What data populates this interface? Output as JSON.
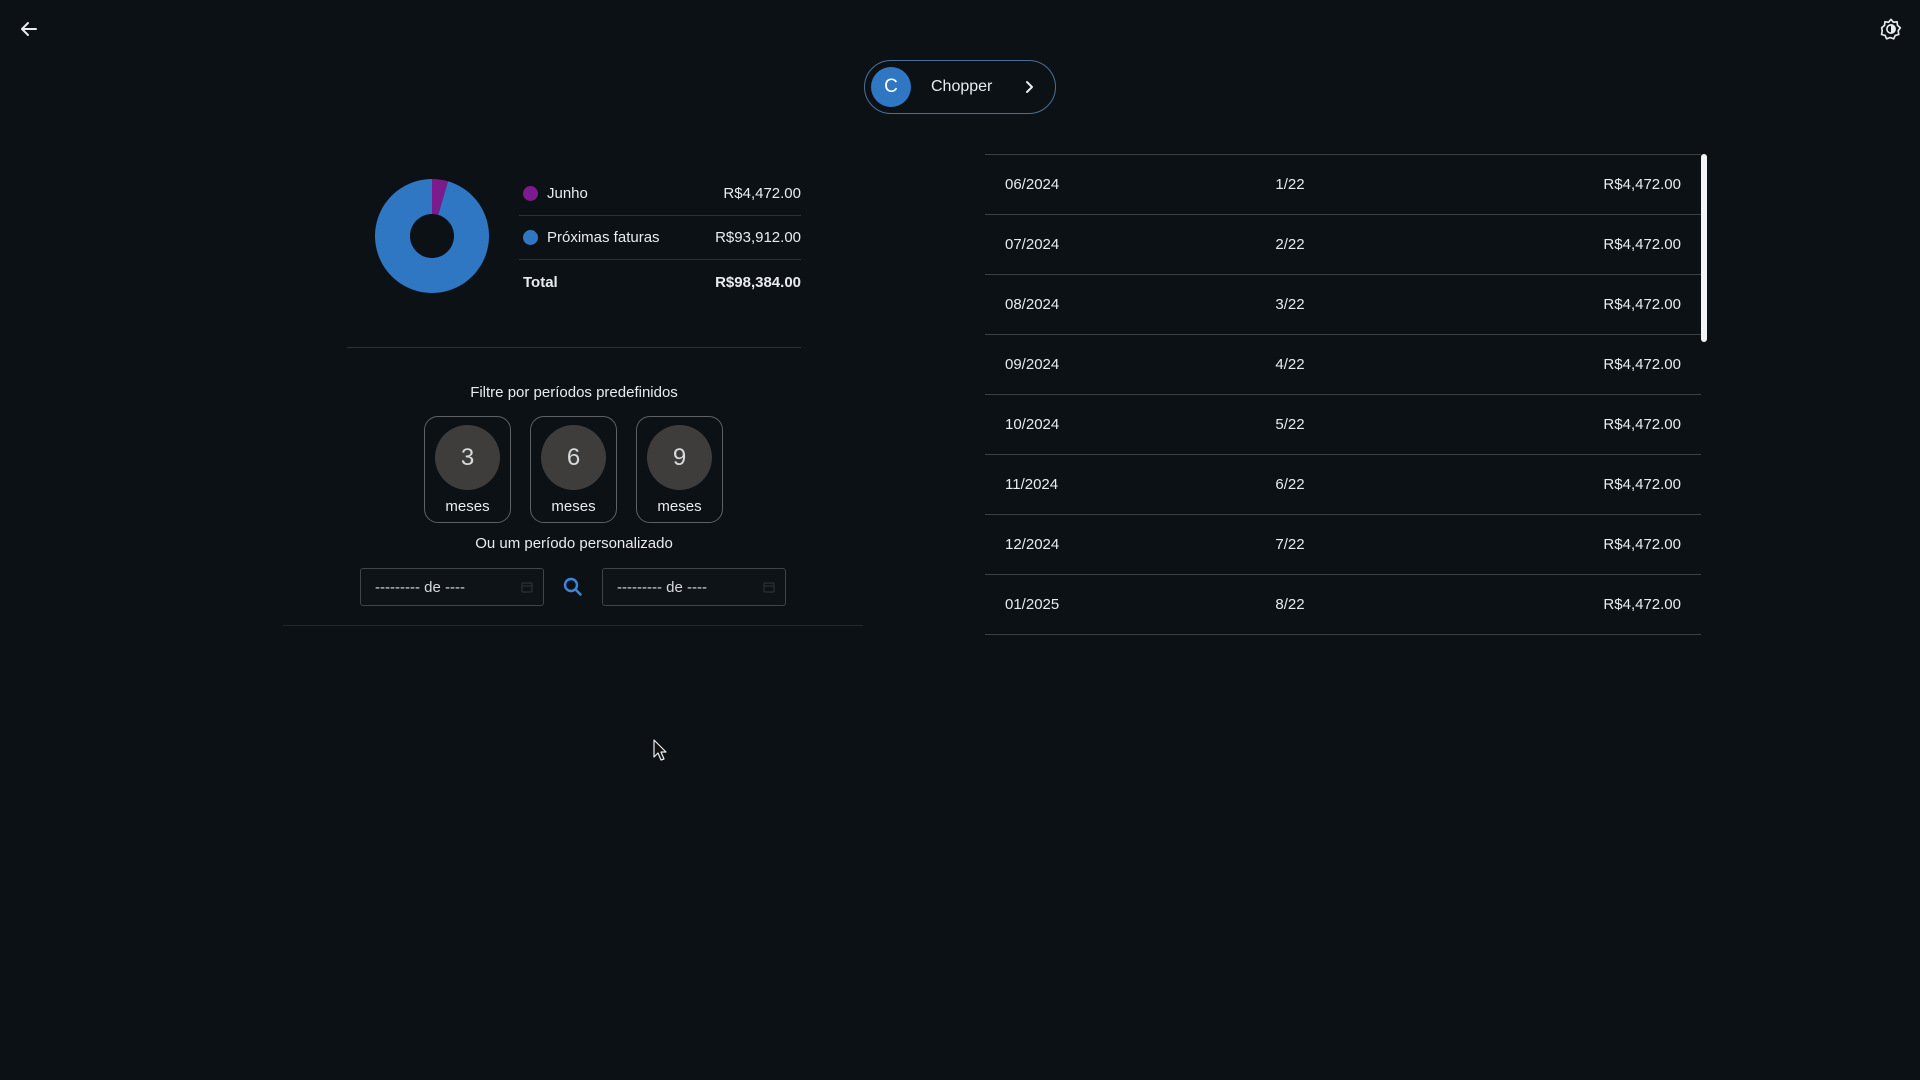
{
  "header": {
    "back_icon": "arrow-left-icon",
    "theme_icon": "brightness-icon"
  },
  "card": {
    "avatar_letter": "C",
    "name": "Chopper",
    "avatar_color": "#2f76c3"
  },
  "summary": {
    "legend": [
      {
        "label": "Junho",
        "value": "R$4,472.00",
        "color": "#7b1b8e"
      },
      {
        "label": "Próximas faturas",
        "value": "R$93,912.00",
        "color": "#2f76c3"
      }
    ],
    "total_label": "Total",
    "total_value": "R$98,384.00"
  },
  "chart_data": {
    "type": "pie",
    "categories": [
      "Junho",
      "Próximas faturas"
    ],
    "values": [
      4472.0,
      93912.0
    ],
    "colors": [
      "#7b1b8e",
      "#2f76c3"
    ],
    "title": "",
    "donut": true
  },
  "filters": {
    "preset_title": "Filtre por períodos predefinidos",
    "presets": [
      {
        "value": "3",
        "unit": "meses"
      },
      {
        "value": "6",
        "unit": "meses"
      },
      {
        "value": "9",
        "unit": "meses"
      }
    ],
    "custom_title": "Ou um período personalizado",
    "start_month_display": "--------- de ----",
    "end_month_display": "--------- de ----"
  },
  "invoices": [
    {
      "date": "06/2024",
      "installment": "1/22",
      "amount": "R$4,472.00"
    },
    {
      "date": "07/2024",
      "installment": "2/22",
      "amount": "R$4,472.00"
    },
    {
      "date": "08/2024",
      "installment": "3/22",
      "amount": "R$4,472.00"
    },
    {
      "date": "09/2024",
      "installment": "4/22",
      "amount": "R$4,472.00"
    },
    {
      "date": "10/2024",
      "installment": "5/22",
      "amount": "R$4,472.00"
    },
    {
      "date": "11/2024",
      "installment": "6/22",
      "amount": "R$4,472.00"
    },
    {
      "date": "12/2024",
      "installment": "7/22",
      "amount": "R$4,472.00"
    },
    {
      "date": "01/2025",
      "installment": "8/22",
      "amount": "R$4,472.00"
    }
  ]
}
